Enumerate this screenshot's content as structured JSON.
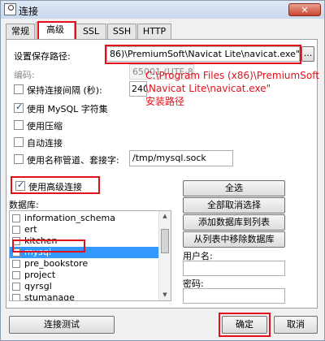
{
  "window": {
    "title": "连接",
    "close_glyph": "✕"
  },
  "tabs": [
    {
      "label": "常规"
    },
    {
      "label": "高级"
    },
    {
      "label": "SSL"
    },
    {
      "label": "SSH"
    },
    {
      "label": "HTTP"
    }
  ],
  "settings": {
    "save_path_label": "设置保存路径:",
    "save_path_value": "86)\\PremiumSoft\\Navicat Lite\\navicat.exe\"",
    "browse_label": "...",
    "encoding_label": "编码:",
    "encoding_value": "65001 (UTF-8)",
    "keepalive_label": "保持连接间隔 (秒):",
    "keepalive_value": "240",
    "use_charset_label": "使用 MySQL 字符集",
    "use_compression_label": "使用压缩",
    "auto_connect_label": "自动连接",
    "named_pipe_label": "使用名称管道、套接字:",
    "socket_value": "/tmp/mysql.sock",
    "use_advanced_label": "使用高级连接"
  },
  "annotation": {
    "line1": "C:\\Program Files (x86)\\PremiumSoft",
    "line2": "\\Navicat Lite\\navicat.exe\"",
    "line3": "安装路径"
  },
  "databases": {
    "label": "数据库:",
    "items": [
      {
        "name": "information_schema"
      },
      {
        "name": "ert"
      },
      {
        "name": "kitchen"
      },
      {
        "name": "mysql"
      },
      {
        "name": "pre_bookstore"
      },
      {
        "name": "project"
      },
      {
        "name": "qyrsgl"
      },
      {
        "name": "stumanage"
      }
    ]
  },
  "db_buttons": {
    "select_all": "全选",
    "deselect_all": "全部取消选择",
    "add_to_list": "添加数据库到列表",
    "remove_from_list": "从列表中移除数据库"
  },
  "credentials": {
    "username_label": "用户名:",
    "password_label": "密码:"
  },
  "footer": {
    "test_label": "连接测试",
    "ok_label": "确定",
    "cancel_label": "取消"
  },
  "colors": {
    "annotation_red": "#e3101b",
    "selection_blue": "#3399ff"
  }
}
